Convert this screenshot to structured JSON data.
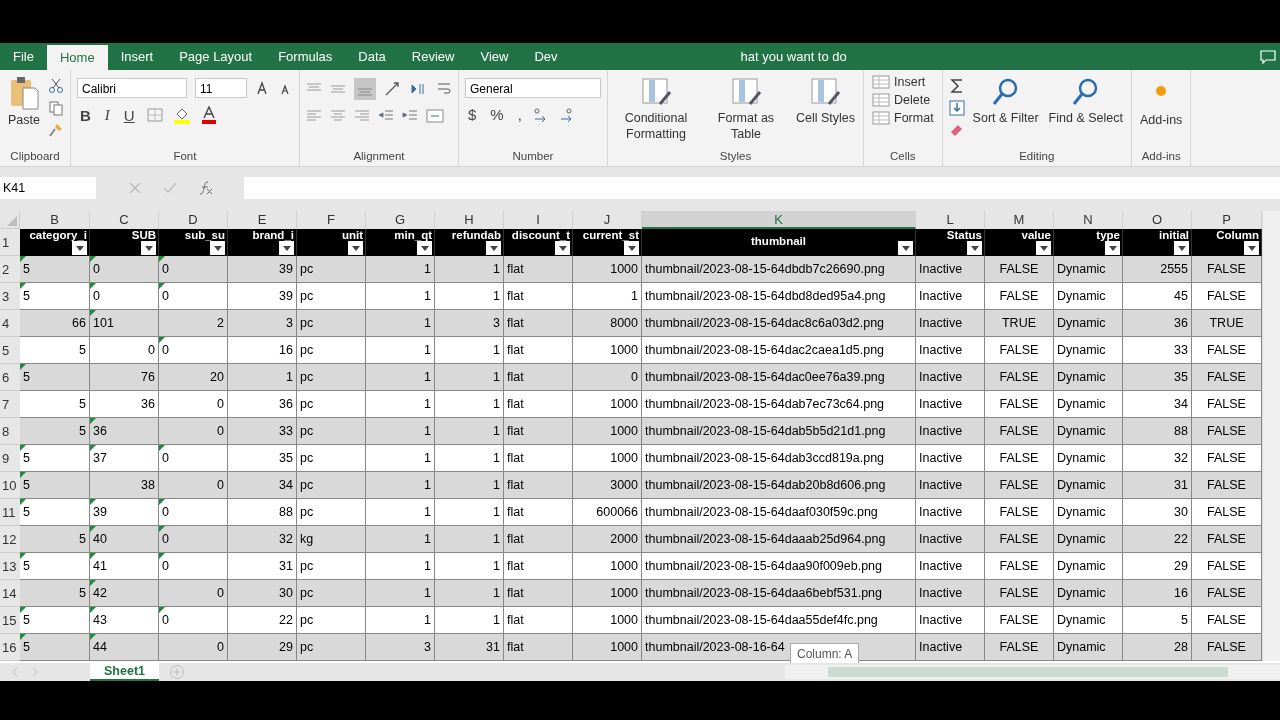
{
  "tabs": [
    {
      "label": "File",
      "selected": false
    },
    {
      "label": "Home",
      "selected": true
    },
    {
      "label": "Insert",
      "selected": false
    },
    {
      "label": "Page Layout",
      "selected": false
    },
    {
      "label": "Formulas",
      "selected": false
    },
    {
      "label": "Data",
      "selected": false
    },
    {
      "label": "Review",
      "selected": false
    },
    {
      "label": "View",
      "selected": false
    },
    {
      "label": "Dev",
      "selected": false
    }
  ],
  "tell_me": "hat you want to do",
  "ribbon": {
    "clipboard": {
      "label": "Clipboard",
      "paste": "Paste"
    },
    "font": {
      "label": "Font",
      "family": "Calibri",
      "size": "11",
      "style_buttons": [
        "B",
        "I",
        "U"
      ]
    },
    "alignment": {
      "label": "Alignment"
    },
    "number": {
      "label": "Number",
      "format": "General",
      "symbols": [
        "$",
        "%",
        ","
      ]
    },
    "styles": {
      "label": "Styles",
      "buttons": [
        "Conditional Formatting",
        "Format as Table",
        "Cell Styles"
      ]
    },
    "cells": {
      "label": "Cells",
      "buttons": [
        "Insert",
        "Delete",
        "Format"
      ]
    },
    "editing": {
      "label": "Editing",
      "buttons": [
        "Sort & Filter",
        "Find & Select"
      ]
    },
    "addins": {
      "label": "Add-ins",
      "buttons": [
        "Add-ins"
      ]
    }
  },
  "name_box": "K41",
  "column_letters": [
    {
      "label": "B",
      "selected": false
    },
    {
      "label": "C",
      "selected": false
    },
    {
      "label": "D",
      "selected": false
    },
    {
      "label": "E",
      "selected": false
    },
    {
      "label": "F",
      "selected": false
    },
    {
      "label": "G",
      "selected": false
    },
    {
      "label": "H",
      "selected": false
    },
    {
      "label": "I",
      "selected": false
    },
    {
      "label": "J",
      "selected": false
    },
    {
      "label": "K",
      "selected": true
    },
    {
      "label": "L",
      "selected": false
    },
    {
      "label": "M",
      "selected": false
    },
    {
      "label": "N",
      "selected": false
    },
    {
      "label": "O",
      "selected": false
    },
    {
      "label": "P",
      "selected": false
    }
  ],
  "header_row": {
    "number": "1",
    "labels": [
      "category_i",
      "SUB",
      "sub_su",
      "brand_i",
      "unit",
      "min_qt",
      "refundab",
      "discount_t",
      "current_st",
      "thumbnail",
      "Status",
      "value",
      "type",
      "initial",
      "Column"
    ]
  },
  "rows": [
    {
      "number": "2",
      "ids": [
        {
          "text": "5",
          "as_text": true
        },
        {
          "text": "0",
          "as_text": true
        },
        {
          "text": "0",
          "as_text": true
        }
      ],
      "cells": [
        "39",
        "pc",
        "1",
        "1",
        "flat",
        "1000",
        "thumbnail/2023-08-15-64dbdb7c26690.png",
        "Inactive",
        "FALSE",
        "Dynamic",
        "2555",
        "FALSE"
      ]
    },
    {
      "number": "3",
      "ids": [
        {
          "text": "5",
          "as_text": true
        },
        {
          "text": "0",
          "as_text": true
        },
        {
          "text": "0",
          "as_text": true
        }
      ],
      "cells": [
        "39",
        "pc",
        "1",
        "1",
        "flat",
        "1",
        "thumbnail/2023-08-15-64dbd8ded95a4.png",
        "Inactive",
        "FALSE",
        "Dynamic",
        "45",
        "FALSE"
      ]
    },
    {
      "number": "4",
      "ids": [
        {
          "text": "66",
          "as_text": false
        },
        {
          "text": "101",
          "as_text": true
        },
        {
          "text": "2",
          "as_text": false
        }
      ],
      "cells": [
        "3",
        "pc",
        "1",
        "3",
        "flat",
        "8000",
        "thumbnail/2023-08-15-64dac8c6a03d2.png",
        "Inactive",
        "TRUE",
        "Dynamic",
        "36",
        "TRUE"
      ]
    },
    {
      "number": "5",
      "ids": [
        {
          "text": "5",
          "as_text": false
        },
        {
          "text": "0",
          "as_text": false
        },
        {
          "text": "0",
          "as_text": true
        }
      ],
      "cells": [
        "16",
        "pc",
        "1",
        "1",
        "flat",
        "1000",
        "thumbnail/2023-08-15-64dac2caea1d5.png",
        "Inactive",
        "FALSE",
        "Dynamic",
        "33",
        "FALSE"
      ]
    },
    {
      "number": "6",
      "ids": [
        {
          "text": "5",
          "as_text": true
        },
        {
          "text": "76",
          "as_text": false
        },
        {
          "text": "20",
          "as_text": false
        }
      ],
      "cells": [
        "1",
        "pc",
        "1",
        "1",
        "flat",
        "0",
        "thumbnail/2023-08-15-64dac0ee76a39.png",
        "Inactive",
        "FALSE",
        "Dynamic",
        "35",
        "FALSE"
      ]
    },
    {
      "number": "7",
      "ids": [
        {
          "text": "5",
          "as_text": false
        },
        {
          "text": "36",
          "as_text": false
        },
        {
          "text": "0",
          "as_text": false
        }
      ],
      "cells": [
        "36",
        "pc",
        "1",
        "1",
        "flat",
        "1000",
        "thumbnail/2023-08-15-64dab7ec73c64.png",
        "Inactive",
        "FALSE",
        "Dynamic",
        "34",
        "FALSE"
      ]
    },
    {
      "number": "8",
      "ids": [
        {
          "text": "5",
          "as_text": false
        },
        {
          "text": "36",
          "as_text": true
        },
        {
          "text": "0",
          "as_text": false
        }
      ],
      "cells": [
        "33",
        "pc",
        "1",
        "1",
        "flat",
        "1000",
        "thumbnail/2023-08-15-64dab5b5d21d1.png",
        "Inactive",
        "FALSE",
        "Dynamic",
        "88",
        "FALSE"
      ]
    },
    {
      "number": "9",
      "ids": [
        {
          "text": "5",
          "as_text": true
        },
        {
          "text": "37",
          "as_text": true
        },
        {
          "text": "0",
          "as_text": true
        }
      ],
      "cells": [
        "35",
        "pc",
        "1",
        "1",
        "flat",
        "1000",
        "thumbnail/2023-08-15-64dab3ccd819a.png",
        "Inactive",
        "FALSE",
        "Dynamic",
        "32",
        "FALSE"
      ]
    },
    {
      "number": "10",
      "ids": [
        {
          "text": "5",
          "as_text": true
        },
        {
          "text": "38",
          "as_text": false
        },
        {
          "text": "0",
          "as_text": false
        }
      ],
      "cells": [
        "34",
        "pc",
        "1",
        "1",
        "flat",
        "3000",
        "thumbnail/2023-08-15-64dab20b8d606.png",
        "Inactive",
        "FALSE",
        "Dynamic",
        "31",
        "FALSE"
      ]
    },
    {
      "number": "11",
      "ids": [
        {
          "text": "5",
          "as_text": true
        },
        {
          "text": "39",
          "as_text": true
        },
        {
          "text": "0",
          "as_text": true
        }
      ],
      "cells": [
        "88",
        "pc",
        "1",
        "1",
        "flat",
        "600066",
        "thumbnail/2023-08-15-64daaf030f59c.png",
        "Inactive",
        "FALSE",
        "Dynamic",
        "30",
        "FALSE"
      ]
    },
    {
      "number": "12",
      "ids": [
        {
          "text": "5",
          "as_text": false
        },
        {
          "text": "40",
          "as_text": true
        },
        {
          "text": "0",
          "as_text": true
        }
      ],
      "cells": [
        "32",
        "kg",
        "1",
        "1",
        "flat",
        "2000",
        "thumbnail/2023-08-15-64daaab25d964.png",
        "Inactive",
        "FALSE",
        "Dynamic",
        "22",
        "FALSE"
      ]
    },
    {
      "number": "13",
      "ids": [
        {
          "text": "5",
          "as_text": true
        },
        {
          "text": "41",
          "as_text": true
        },
        {
          "text": "0",
          "as_text": true
        }
      ],
      "cells": [
        "31",
        "pc",
        "1",
        "1",
        "flat",
        "1000",
        "thumbnail/2023-08-15-64daa90f009eb.png",
        "Inactive",
        "FALSE",
        "Dynamic",
        "29",
        "FALSE"
      ]
    },
    {
      "number": "14",
      "ids": [
        {
          "text": "5",
          "as_text": false
        },
        {
          "text": "42",
          "as_text": true
        },
        {
          "text": "0",
          "as_text": false
        }
      ],
      "cells": [
        "30",
        "pc",
        "1",
        "1",
        "flat",
        "1000",
        "thumbnail/2023-08-15-64daa6bebf531.png",
        "Inactive",
        "FALSE",
        "Dynamic",
        "16",
        "FALSE"
      ]
    },
    {
      "number": "15",
      "ids": [
        {
          "text": "5",
          "as_text": true
        },
        {
          "text": "43",
          "as_text": true
        },
        {
          "text": "0",
          "as_text": true
        }
      ],
      "cells": [
        "22",
        "pc",
        "1",
        "1",
        "flat",
        "1000",
        "thumbnail/2023-08-15-64daa55def4fc.png",
        "Inactive",
        "FALSE",
        "Dynamic",
        "5",
        "FALSE"
      ]
    },
    {
      "number": "16",
      "ids": [
        {
          "text": "5",
          "as_text": true
        },
        {
          "text": "44",
          "as_text": true
        },
        {
          "text": "0",
          "as_text": false
        }
      ],
      "cells": [
        "29",
        "pc",
        "3",
        "31",
        "flat",
        "1000",
        "thumbnail/2023-08-16-64",
        "Inactive",
        "FALSE",
        "Dynamic",
        "28",
        "FALSE"
      ]
    }
  ],
  "tooltip": "Column: A",
  "sheet_tabs": [
    {
      "label": "Sheet1",
      "selected": true
    }
  ]
}
